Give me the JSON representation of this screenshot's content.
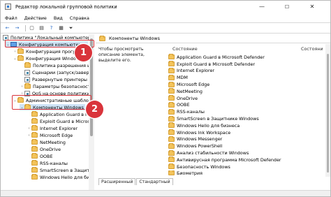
{
  "window": {
    "title": "Редактор локальной групповой политики",
    "controls": {
      "minimize": "—",
      "maximize": "☐",
      "close": "✕"
    }
  },
  "menu": [
    "Файл",
    "Действие",
    "Вид",
    "Справка"
  ],
  "toolbar": {
    "back": "←",
    "forward": "→",
    "up": "▢",
    "properties": "▤",
    "help": "?",
    "show_hide": "▦",
    "filter": "⏷"
  },
  "tree": {
    "root": "Политика \"Локальный компьютер\"",
    "computer_config": "Конфигурация компьютера",
    "items": [
      {
        "label": "Конфигурация програм",
        "indent": 1
      },
      {
        "label": "Конфигурация Windows",
        "indent": 1
      },
      {
        "label": "Политика разрешения име",
        "indent": 2
      },
      {
        "label": "Сценарии (запуск/заверше",
        "indent": 2
      },
      {
        "label": "Развернутые принтеры",
        "indent": 2
      },
      {
        "label": "Параметры безопасности",
        "indent": 2
      },
      {
        "label": "QoS на основе политики",
        "indent": 2
      }
    ],
    "admin_templates": "Административные шаблоны",
    "windows_components": "Компоненты Windows",
    "components": [
      "Application Guard в Microsoft",
      "Exploit Guard в Microsoft Def",
      "Internet Explorer",
      "Microsoft Edge",
      "NetMeeting",
      "OneDrive",
      "OOBE",
      "RSS-каналы",
      "SmartScreen в Защитнике",
      "Windows Hello для бизн"
    ]
  },
  "badges": {
    "one": "1",
    "two": "2"
  },
  "right": {
    "header": "Компоненты Windows",
    "description": "Чтобы просмотреть описание элемента, выделите его.",
    "col_setting": "Состояние",
    "col_state": "Состояни",
    "items": [
      "Application Guard в Microsoft Defender",
      "Exploit Guard в Microsoft Defender",
      "Internet Explorer",
      "MDM",
      "Microsoft Edge",
      "NetMeeting",
      "OneDrive",
      "OOBE",
      "RSS-каналы",
      "SmartScreen в Защитнике Windows",
      "Windows Hello для бизнеса",
      "Windows Ink Workspace",
      "Windows Messenger",
      "Windows PowerShell",
      "Анализ стабильности Windows",
      "Антивирусная программа Microsoft Defender",
      "Безопасность Windows",
      "Биометрия"
    ],
    "tabs": [
      "Расширенный",
      "Стандартный"
    ]
  }
}
